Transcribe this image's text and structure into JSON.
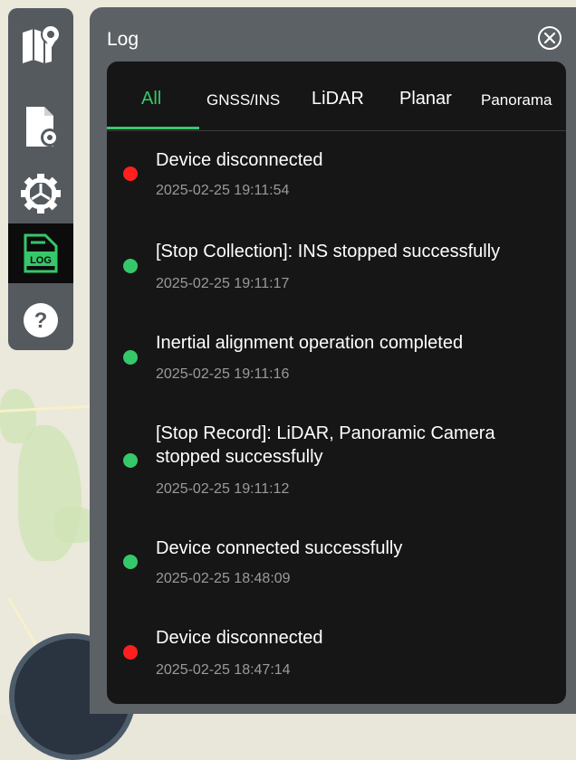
{
  "panel": {
    "title": "Log"
  },
  "tabs": [
    {
      "label": "All",
      "active": true
    },
    {
      "label": "GNSS/INS",
      "active": false
    },
    {
      "label": "LiDAR",
      "active": false
    },
    {
      "label": "Planar",
      "active": false
    },
    {
      "label": "Panorama",
      "active": false
    }
  ],
  "logs": [
    {
      "message": "Device disconnected",
      "time": "2025-02-25 19:11:54",
      "status": "error"
    },
    {
      "message": "[Stop Collection]: INS stopped successfully",
      "time": "2025-02-25 19:11:17",
      "status": "success"
    },
    {
      "message": "Inertial alignment operation completed",
      "time": "2025-02-25 19:11:16",
      "status": "success"
    },
    {
      "message": "[Stop Record]: LiDAR, Panoramic Camera stopped successfully",
      "time": "2025-02-25 19:11:12",
      "status": "success"
    },
    {
      "message": "Device connected successfully",
      "time": "2025-02-25 18:48:09",
      "status": "success"
    },
    {
      "message": "Device disconnected",
      "time": "2025-02-25 18:47:14",
      "status": "error"
    }
  ],
  "toolbar": {
    "items": [
      {
        "icon": "map-pin-icon",
        "active": false
      },
      {
        "icon": "file-settings-icon",
        "active": false
      },
      {
        "icon": "gear-icon",
        "active": false
      },
      {
        "icon": "log-icon",
        "label": "LOG",
        "active": true
      },
      {
        "icon": "help-icon",
        "label": "?",
        "active": false
      }
    ]
  },
  "colors": {
    "accent": "#35c86a",
    "error": "#ff1f1f",
    "success": "#35c86a",
    "panel": "#161616"
  }
}
